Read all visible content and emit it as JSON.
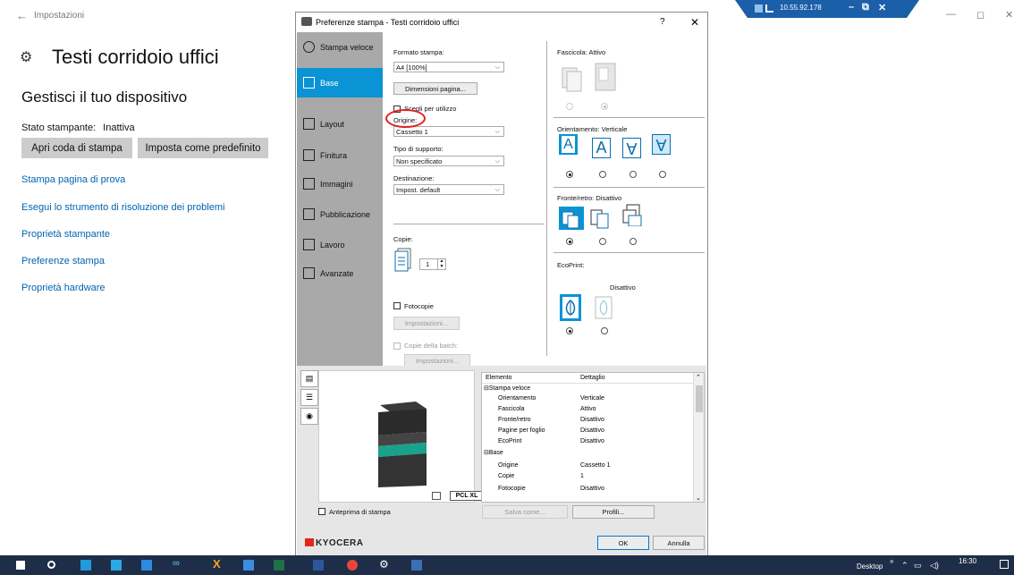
{
  "settings": {
    "app_title": "Impostazioni",
    "printer_name": "Testi corridoio uffici",
    "manage_heading": "Gestisci il tuo dispositivo",
    "status_label": "Stato stampante:",
    "status_value": "Inattiva",
    "open_queue_button": "Apri coda di stampa",
    "set_default_button": "Imposta come predefinito",
    "links": [
      "Stampa pagina di prova",
      "Esegui lo strumento di risoluzione dei problemi",
      "Proprietà stampante",
      "Preferenze stampa",
      "Proprietà hardware"
    ]
  },
  "remote": {
    "ip": "10.55.92.178"
  },
  "dialog": {
    "title": "Preferenze stampa - Testi corridoio uffici",
    "help": "?",
    "close": "✕",
    "nav": [
      {
        "label": "Stampa veloce",
        "icon": "clock-icon"
      },
      {
        "label": "Base",
        "icon": "base-icon",
        "active": true
      },
      {
        "label": "Layout",
        "icon": "layout-icon"
      },
      {
        "label": "Finitura",
        "icon": "finishing-icon"
      },
      {
        "label": "Immagini",
        "icon": "image-icon"
      },
      {
        "label": "Pubblicazione",
        "icon": "publish-icon"
      },
      {
        "label": "Lavoro",
        "icon": "job-icon"
      },
      {
        "label": "Avanzate",
        "icon": "advanced-icon"
      }
    ],
    "base": {
      "formato_label": "Formato stampa:",
      "formato_value": "A4  [100%]",
      "dimensioni_button": "Dimensioni pagina...",
      "scegli_label": "Scegli per utilizzo",
      "origine_label": "Origine:",
      "origine_value": "Cassetto 1",
      "supporto_label": "Tipo di supporto:",
      "supporto_value": "Non specificato",
      "destinazione_label": "Destinazione:",
      "destinazione_value": "Impost. default",
      "copie_label": "Copie:",
      "copie_value": "1",
      "fotocopie_label": "Fotocopie",
      "impostazioni_button": "Impostazioni...",
      "batch_label": "Copie della batch:",
      "batch_button": "Impostazioni..."
    },
    "right": {
      "fascicola_label": "Fascicola:",
      "fascicola_value": "Attivo",
      "orient_label": "Orientamento:",
      "orient_value": "Verticale",
      "fronte_label": "Fronte/retro:",
      "fronte_value": "Disattivo",
      "ecoprint_label": "EcoPrint:",
      "ecoprint_value": "Disattivo"
    },
    "preview": {
      "pcl": "PCL XL",
      "table_header": [
        "Elemento",
        "Dettaglio"
      ],
      "rows": [
        {
          "item": "⊟Stampa veloce",
          "detail": "",
          "indent": false
        },
        {
          "item": "Orientamento",
          "detail": "Verticale",
          "indent": true
        },
        {
          "item": "Fascicola",
          "detail": "Attivo",
          "indent": true
        },
        {
          "item": "Fronte/retro",
          "detail": "Disattivo",
          "indent": true
        },
        {
          "item": "Pagine per foglio",
          "detail": "Disattivo",
          "indent": true
        },
        {
          "item": "EcoPrint",
          "detail": "Disattivo",
          "indent": true
        },
        {
          "item": "⊟Base",
          "detail": "",
          "indent": false
        },
        {
          "item": "Origine",
          "detail": "Cassetto 1",
          "indent": true
        },
        {
          "item": "Copie",
          "detail": "1",
          "indent": true
        },
        {
          "item": "Fotocopie",
          "detail": "Disattivo",
          "indent": true
        }
      ],
      "anteprima_label": "Anteprima di stampa",
      "salva_button": "Salva come...",
      "profili_button": "Profili..."
    },
    "logo": "KYOCERA",
    "ok_button": "OK",
    "annulla_button": "Annulla"
  },
  "taskbar": {
    "desktop_label": "Desktop",
    "chevron": "»",
    "time": "16:30"
  }
}
